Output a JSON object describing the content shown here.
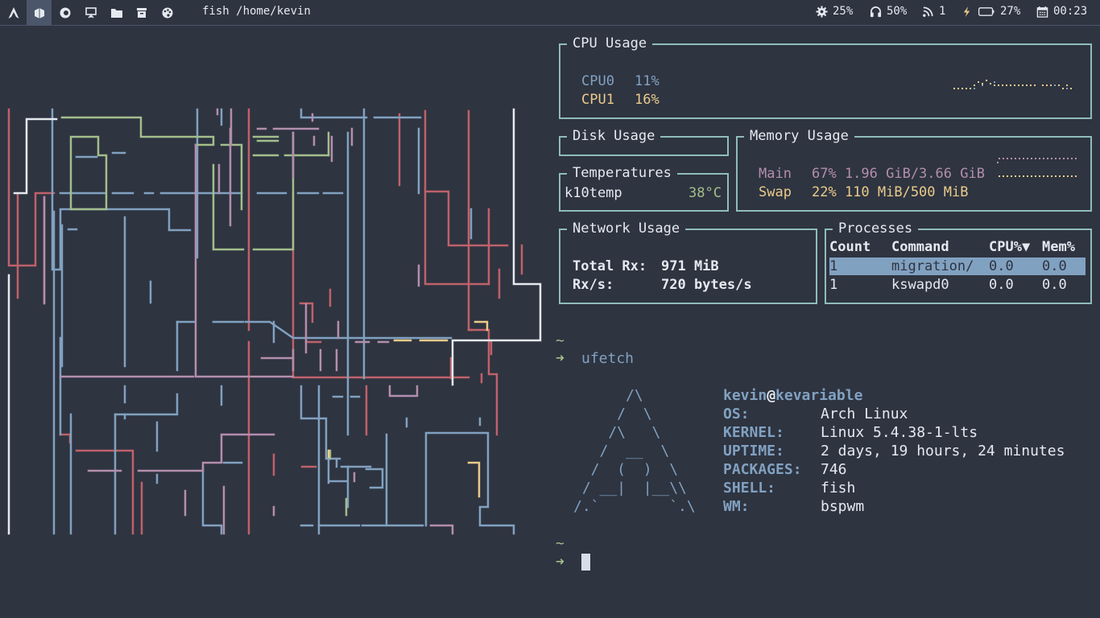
{
  "topbar": {
    "workspaces": [
      {
        "icon": "arch-icon"
      },
      {
        "icon": "terminal-icon"
      },
      {
        "icon": "firefox-icon"
      },
      {
        "icon": "presentation-icon"
      },
      {
        "icon": "folder-icon"
      },
      {
        "icon": "trash-icon"
      },
      {
        "icon": "palette-icon"
      }
    ],
    "window_title": "fish /home/kevin",
    "stats": {
      "cpu": "25%",
      "volume": "50%",
      "network": "1",
      "battery": "27%",
      "clock": "00:23"
    }
  },
  "cpu_usage": {
    "title": "CPU Usage",
    "cores": [
      {
        "label": "CPU0",
        "value": "11%"
      },
      {
        "label": "CPU1",
        "value": "16%"
      }
    ]
  },
  "disk_usage": {
    "title": "Disk Usage"
  },
  "temperatures": {
    "title": "Temperatures",
    "sensor": "k10temp",
    "value": "38°C"
  },
  "memory_usage": {
    "title": "Memory Usage",
    "main_label": "Main",
    "main_value": "67% 1.96 GiB/3.66 GiB",
    "swap_label": "Swap",
    "swap_value": "22% 110 MiB/500 MiB"
  },
  "network_usage": {
    "title": "Network Usage",
    "total_rx_label": "Total Rx:",
    "total_rx_value": "971 MiB",
    "rx_label": "Rx/s:",
    "rx_value": "720 bytes/s"
  },
  "processes": {
    "title": "Processes",
    "columns": [
      "Count",
      "Command",
      "CPU%▼",
      "Mem%"
    ],
    "rows": [
      [
        "1",
        "migration/",
        "0.0",
        "0.0"
      ],
      [
        "1",
        "kswapd0",
        "0.0",
        "0.0"
      ]
    ]
  },
  "terminal": {
    "prompt_dir": "~",
    "prompt_arrow": "➜",
    "command": "ufetch",
    "ascii_logo": [
      "      /\\",
      "     /  \\",
      "    /\\   \\",
      "   /  __  \\",
      "  /  (  )  \\",
      " / __|  |__\\\\",
      "/.`        `.\\"
    ],
    "user": "kevin",
    "at": "@",
    "host": "kevariable",
    "info": [
      {
        "label": "OS:",
        "value": "Arch Linux"
      },
      {
        "label": "KERNEL:",
        "value": "Linux 5.4.38-1-lts"
      },
      {
        "label": "UPTIME:",
        "value": "2 days, 19 hours, 24 minutes"
      },
      {
        "label": "PACKAGES:",
        "value": "746"
      },
      {
        "label": "SHELL:",
        "value": "fish"
      },
      {
        "label": "WM:",
        "value": "bspwm"
      }
    ],
    "prompt2_dir": "~",
    "prompt2_arrow": "➜"
  },
  "colors": {
    "background": "#2e3440",
    "border": "#8fbcbb",
    "blue": "#81a1c1",
    "yellow": "#ebcb8b",
    "pink": "#b48ead",
    "green": "#a3be8c",
    "red": "#bf616a",
    "white": "#e5e9f0"
  }
}
